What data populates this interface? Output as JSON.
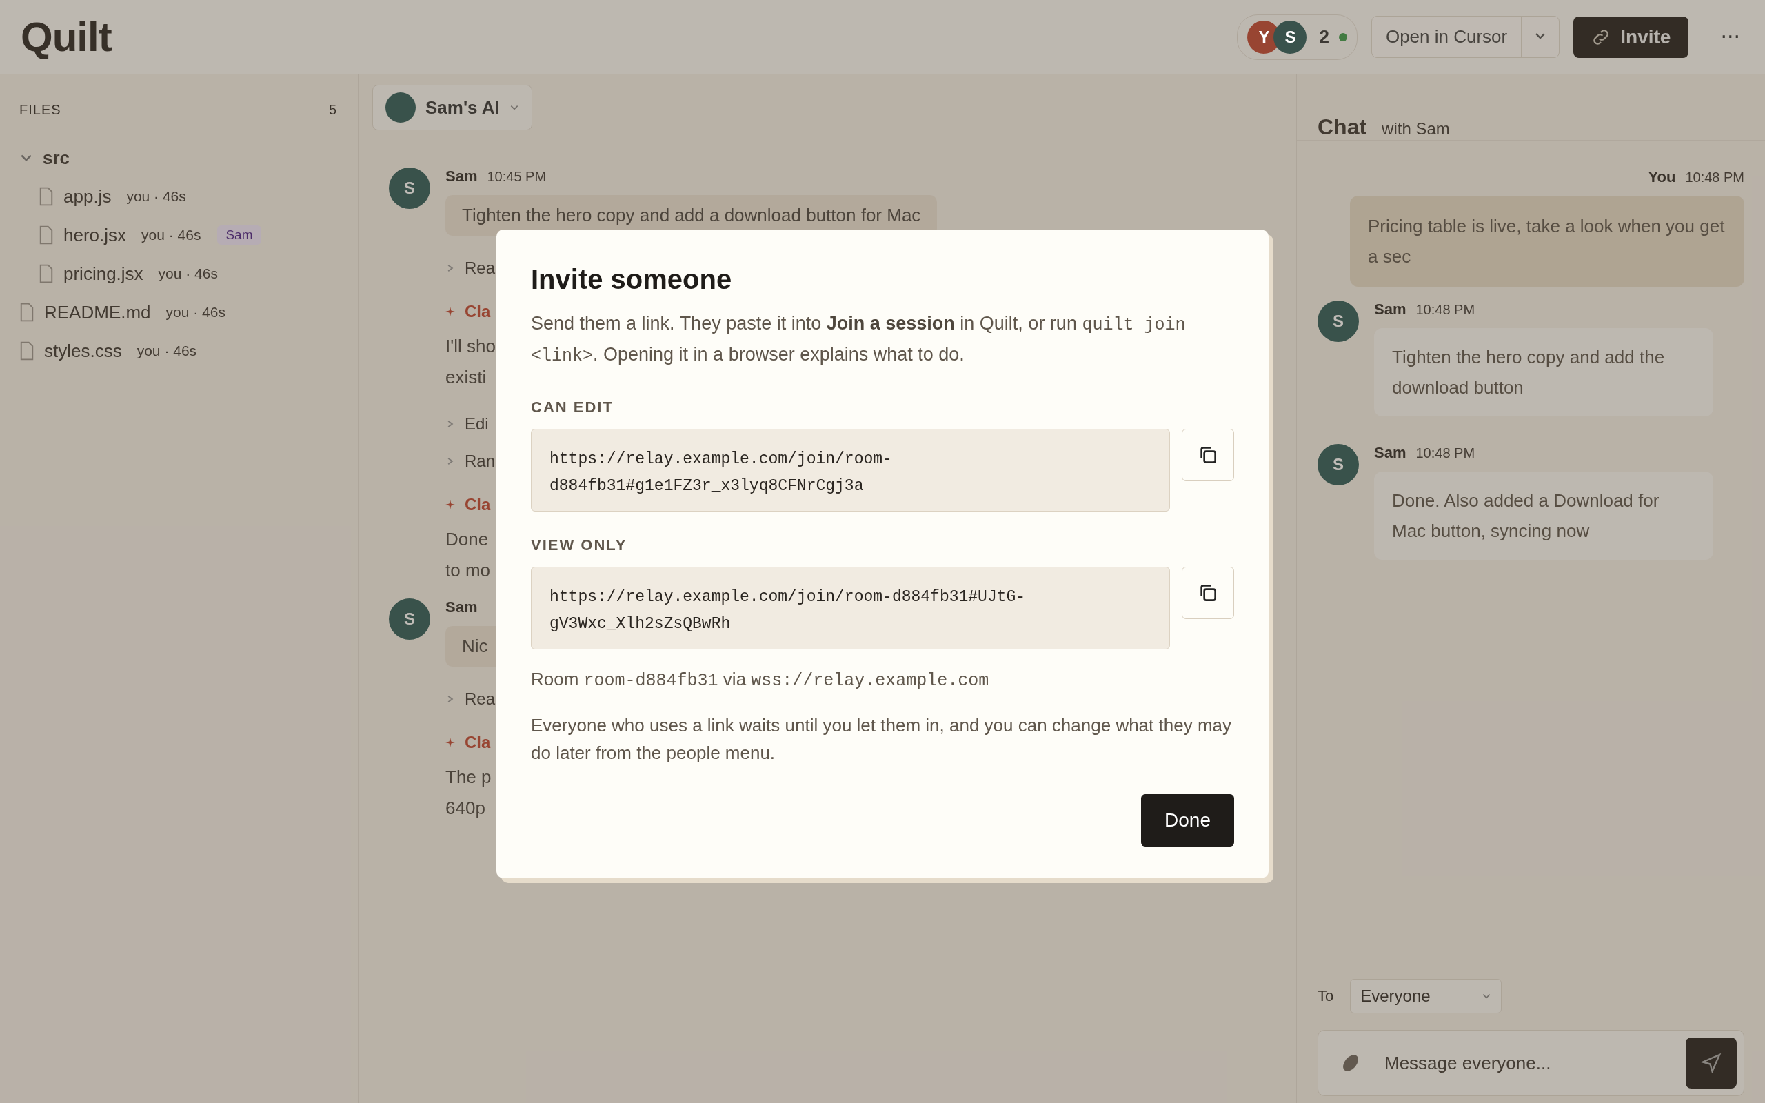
{
  "header": {
    "logo": "Quilt",
    "presence": {
      "avatars": [
        {
          "initial": "Y",
          "color": "#984532"
        },
        {
          "initial": "S",
          "color": "#39524c"
        }
      ],
      "count": "2",
      "online": true
    },
    "open_button": "Open in Cursor",
    "invite_button": "Invite",
    "more": "···"
  },
  "sidebar": {
    "title": "FILES",
    "count": "5",
    "tree": [
      {
        "name": "src",
        "kind": "folder",
        "expanded": true,
        "children": [
          {
            "name": "app.js",
            "kind": "file",
            "meta": "you · 46s"
          },
          {
            "name": "hero.jsx",
            "kind": "file",
            "meta": "you · 46s",
            "badge": "Sam"
          },
          {
            "name": "pricing.jsx",
            "kind": "file",
            "meta": "you · 46s"
          }
        ]
      },
      {
        "name": "README.md",
        "kind": "file",
        "meta": "you · 46s"
      },
      {
        "name": "styles.css",
        "kind": "file",
        "meta": "you · 46s"
      }
    ]
  },
  "agent_tab": {
    "label": "Sam's AI"
  },
  "thread": [
    {
      "kind": "message",
      "initial": "S",
      "sender": "Sam",
      "time": "10:45 PM",
      "text": "Tighten the hero copy and add a download button for Mac"
    },
    {
      "kind": "step",
      "text": "Rea"
    },
    {
      "kind": "agent",
      "text": "Cla"
    },
    {
      "kind": "paragraph",
      "lines": [
        "I'll sho",
        "existi"
      ]
    },
    {
      "kind": "step",
      "text": "Edi"
    },
    {
      "kind": "step",
      "text": "Ran"
    },
    {
      "kind": "agent",
      "text": "Cla"
    },
    {
      "kind": "paragraph",
      "lines": [
        "Done",
        "to mo"
      ]
    },
    {
      "kind": "message",
      "initial": "S",
      "sender": "Sam",
      "text": "Nic"
    },
    {
      "kind": "step",
      "text": "Rea"
    },
    {
      "kind": "agent",
      "text": "Cla"
    },
    {
      "kind": "paragraph",
      "lines": [
        "The p",
        "640p"
      ]
    }
  ],
  "chat": {
    "title": "Chat",
    "subtitle": "with Sam",
    "messages": [
      {
        "kind": "sent",
        "sender": "You",
        "time": "10:48 PM",
        "text": "Pricing table is live, take a look when you get a sec"
      },
      {
        "kind": "received",
        "initial": "S",
        "sender": "Sam",
        "time": "10:48 PM",
        "text": "Tighten the hero copy and add the download button"
      },
      {
        "kind": "received",
        "initial": "S",
        "sender": "Sam",
        "time": "10:48 PM",
        "text": "Done. Also added a Download for Mac button, syncing now"
      }
    ],
    "to_label": "To",
    "recipient": "Everyone",
    "composer": {
      "placeholder": "Message everyone..."
    }
  },
  "modal": {
    "title": "Invite someone",
    "description": [
      {
        "kind": "text",
        "text": "Send them a link. They paste it into **Join a session** in Quilt, or run "
      },
      {
        "kind": "code",
        "text": "quilt join <link>"
      },
      {
        "kind": "text",
        "text": ". Opening it in a browser explains what to do."
      }
    ],
    "links": [
      {
        "label": "CAN EDIT",
        "url": "https://relay.example.com/join/room-d884fb31#g1e1FZ3r_x3lyq8CFNrCgj3a"
      },
      {
        "label": "VIEW ONLY",
        "url": "https://relay.example.com/join/room-d884fb31#UJtG-gV3Wxc_Xlh2sZsQBwRh"
      }
    ],
    "room": [
      {
        "kind": "text",
        "text": "Room "
      },
      {
        "kind": "code",
        "text": "room-d884fb31"
      },
      {
        "kind": "text",
        "text": " via "
      },
      {
        "kind": "code",
        "text": "wss://relay.example.com"
      }
    ],
    "note": "Everyone who uses a link waits until you let them in, and you can change what they may do later from the people menu.",
    "done_button": "Done"
  }
}
